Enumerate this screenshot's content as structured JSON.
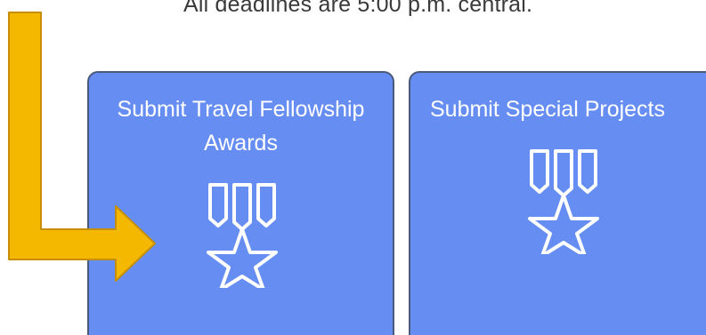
{
  "header": {
    "deadline_note": "All deadlines are 5:00 p.m. central."
  },
  "cards": [
    {
      "title": "Submit Travel Fellowship Awards",
      "icon": "award-medal-icon"
    },
    {
      "title": "Submit Special Projects",
      "icon": "award-medal-icon"
    }
  ],
  "annotation": {
    "icon": "pointer-arrow-icon"
  },
  "colors": {
    "card_background": "#668ef2",
    "card_border": "#4a5a7a",
    "arrow_fill": "#f5b800",
    "arrow_outline": "#c78f00",
    "icon_stroke": "#ffffff"
  }
}
